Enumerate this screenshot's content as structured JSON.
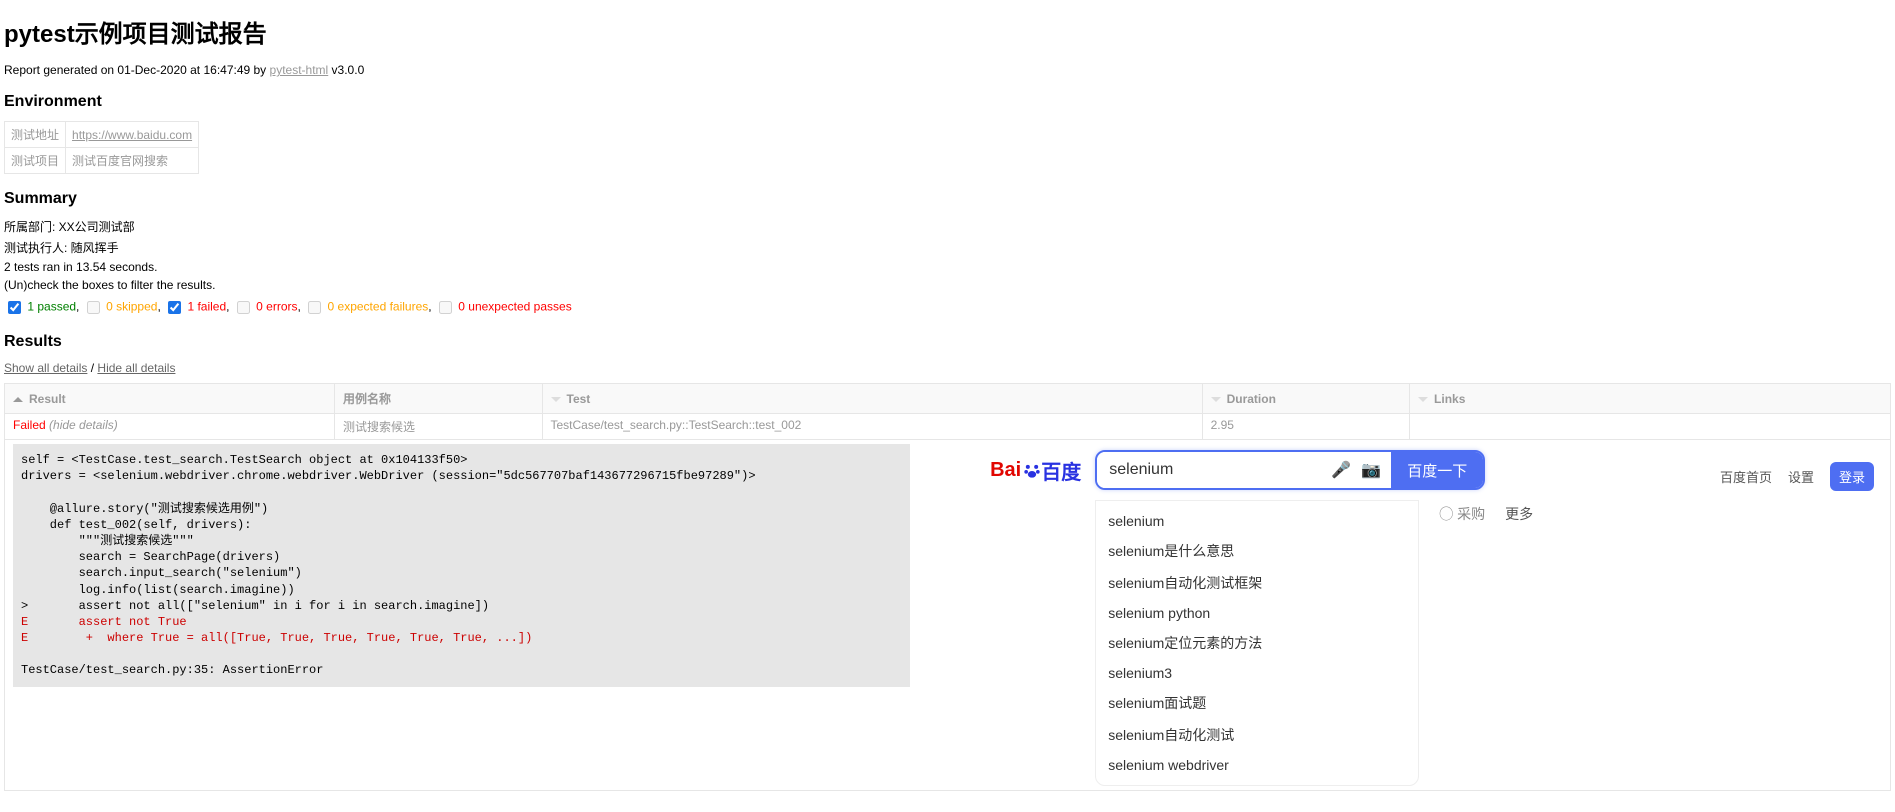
{
  "title": "pytest示例项目测试报告",
  "generated_prefix": "Report generated on 01-Dec-2020 at 16:47:49 by ",
  "generated_link": "pytest-html",
  "generated_suffix": " v3.0.0",
  "sections": {
    "environment": "Environment",
    "summary": "Summary",
    "results": "Results"
  },
  "environment": [
    {
      "key": "测试地址",
      "value": "https://www.baidu.com",
      "is_link": true
    },
    {
      "key": "测试项目",
      "value": "测试百度官网搜索",
      "is_link": false
    }
  ],
  "summary": {
    "dept": "所属部门: XX公司测试部",
    "executor": "测试执行人: 随风挥手",
    "count_line": "2 tests ran in 13.54 seconds.",
    "filter_hint": "(Un)check the boxes to filter the results.",
    "filters": [
      {
        "label": "1 passed",
        "class": "passed",
        "checked": true,
        "enabled": true
      },
      {
        "label": "0 skipped",
        "class": "skipped",
        "checked": false,
        "enabled": false
      },
      {
        "label": "1 failed",
        "class": "failed",
        "checked": true,
        "enabled": true
      },
      {
        "label": "0 errors",
        "class": "error",
        "checked": false,
        "enabled": false
      },
      {
        "label": "0 expected failures",
        "class": "xfailed",
        "checked": false,
        "enabled": false
      },
      {
        "label": "0 unexpected passes",
        "class": "xpassed",
        "checked": false,
        "enabled": false
      }
    ]
  },
  "detail_links": {
    "show": "Show all details",
    "hide": "Hide all details"
  },
  "results_table": {
    "headers": [
      "Result",
      "用例名称",
      "Test",
      "Duration",
      "Links"
    ],
    "row": {
      "result": "Failed",
      "hide": "(hide details)",
      "case_name": "测试搜索候选",
      "test": "TestCase/test_search.py::TestSearch::test_002",
      "duration": "2.95",
      "links": ""
    }
  },
  "log_plain": "self = <TestCase.test_search.TestSearch object at 0x104133f50>\ndrivers = <selenium.webdriver.chrome.webdriver.WebDriver (session=\"5dc567707baf143677296715fbe97289\")>\n\n    @allure.story(\"测试搜索候选用例\")\n    def test_002(self, drivers):\n        \"\"\"测试搜索候选\"\"\"\n        search = SearchPage(drivers)\n        search.input_search(\"selenium\")\n        log.info(list(search.imagine))\n>       assert not all([\"selenium\" in i for i in search.imagine])",
  "log_err1": "E       assert not True",
  "log_err2": "E        +  where True = all([True, True, True, True, True, True, ...])",
  "log_tail": "\nTestCase/test_search.py:35: AssertionError",
  "baidu": {
    "logo_bai": "Bai",
    "logo_du": "百度",
    "search_value": "selenium",
    "button": "百度一下",
    "top_links": [
      "百度首页",
      "设置"
    ],
    "login": "登录",
    "suggestions": [
      "selenium",
      "selenium是什么意思",
      "selenium自动化测试框架",
      "selenium python",
      "selenium定位元素的方法",
      "selenium3",
      "selenium面试题",
      "selenium自动化测试",
      "selenium webdriver"
    ],
    "hot_cart": "采购",
    "hot_more": "更多"
  }
}
